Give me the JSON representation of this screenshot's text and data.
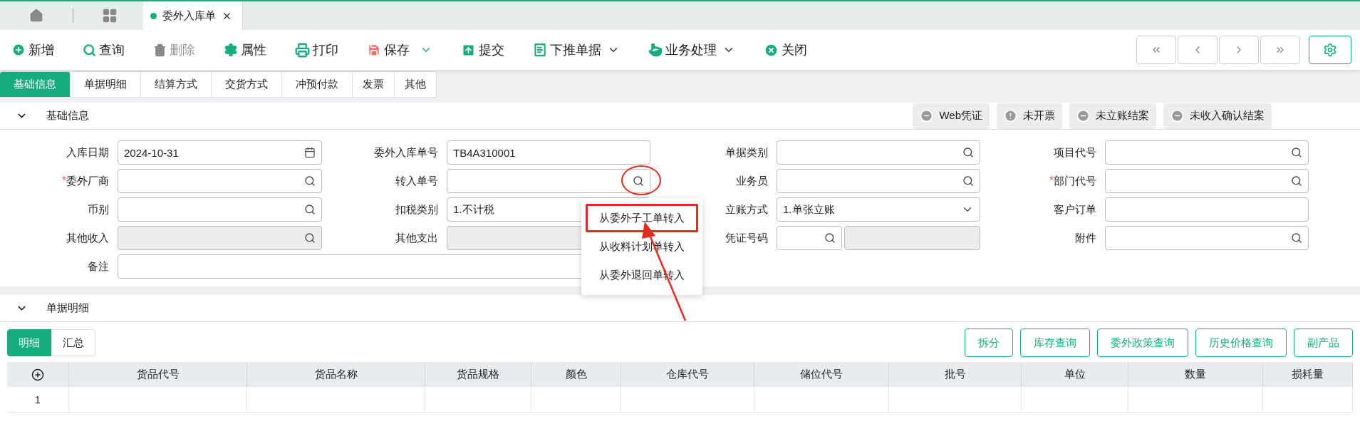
{
  "top_tabs": [
    {
      "label": "委外入库单",
      "selected": true
    }
  ],
  "toolbar": [
    {
      "label": "新增",
      "disabled": false,
      "dropdown": false
    },
    {
      "label": "查询",
      "disabled": false,
      "dropdown": false
    },
    {
      "label": "删除",
      "disabled": true,
      "dropdown": false
    },
    {
      "label": "属性",
      "disabled": false,
      "dropdown": false
    },
    {
      "label": "打印",
      "disabled": false,
      "dropdown": false
    },
    {
      "label": "保存",
      "disabled": false,
      "dropdown": true
    },
    {
      "label": "提交",
      "disabled": false,
      "dropdown": false
    },
    {
      "label": "下推单据",
      "disabled": false,
      "dropdown": true
    },
    {
      "label": "业务处理",
      "disabled": false,
      "dropdown": true
    },
    {
      "label": "关闭",
      "disabled": false,
      "dropdown": false
    }
  ],
  "tabs": [
    {
      "label": "基础信息",
      "selected": true
    },
    {
      "label": "单据明细",
      "selected": false
    },
    {
      "label": "结算方式",
      "selected": false
    },
    {
      "label": "交货方式",
      "selected": false
    },
    {
      "label": "冲预付款",
      "selected": false
    },
    {
      "label": "发票",
      "selected": false
    },
    {
      "label": "其他",
      "selected": false
    }
  ],
  "basic_section": {
    "title": "基础信息",
    "expanded": true,
    "status_buttons": [
      {
        "label": "Web凭证",
        "kind": "minus"
      },
      {
        "label": "未开票",
        "kind": "alert"
      },
      {
        "label": "未立账结案",
        "kind": "minus"
      },
      {
        "label": "未收入确认结案",
        "kind": "minus"
      }
    ],
    "rows": [
      [
        {
          "label": "入库日期",
          "kind": "date",
          "value": "2024-10-31",
          "disabled": false
        },
        {
          "label": "委外入库单号",
          "kind": "text",
          "value": "TB4A310001",
          "disabled": false
        },
        {
          "label": "单据类别",
          "kind": "lookup",
          "disabled": false
        },
        {
          "label": "项目代号",
          "kind": "lookup",
          "disabled": false
        }
      ],
      [
        {
          "label": "委外厂商",
          "kind": "lookup",
          "required_mark": "*",
          "disabled": false
        },
        {
          "label": "转入单号",
          "kind": "lookup",
          "disabled": false,
          "annotated": true
        },
        {
          "label": "业务员",
          "kind": "lookup",
          "disabled": false
        },
        {
          "label": "部门代号",
          "kind": "lookup",
          "required_mark": "*",
          "disabled": false
        }
      ],
      [
        {
          "label": "币别",
          "kind": "lookup",
          "disabled": false
        },
        {
          "label": "扣税类别",
          "kind": "select",
          "value": "1.不计税",
          "disabled": false
        },
        {
          "label": "立账方式",
          "kind": "select",
          "value": "1.单张立账",
          "disabled": false
        },
        {
          "label": "客户订单",
          "kind": "text",
          "disabled": false
        }
      ],
      [
        {
          "label": "其他收入",
          "kind": "lookup",
          "disabled": true
        },
        {
          "label": "其他支出",
          "kind": "lookup",
          "disabled": true
        },
        {
          "label": "凭证号码",
          "kind": "lookup_pair",
          "disabled": false
        },
        {
          "label": "附件",
          "kind": "lookup",
          "disabled": false
        }
      ],
      [
        {
          "label": "备注",
          "kind": "wide",
          "disabled": false
        }
      ]
    ]
  },
  "transfer_menu": {
    "items": [
      {
        "label": "从委外子工单转入",
        "highlighted": true
      },
      {
        "label": "从收料计划单转入",
        "highlighted": false
      },
      {
        "label": "从委外退回单转入",
        "highlighted": false
      }
    ]
  },
  "detail_section": {
    "title": "单据明细",
    "expanded": true,
    "view_tabs": [
      {
        "label": "明细",
        "selected": true
      },
      {
        "label": "汇总",
        "selected": false
      }
    ],
    "buttons": [
      "拆分",
      "库存查询",
      "委外政策查询",
      "历史价格查询",
      "副产品"
    ],
    "table": {
      "columns": [
        "货品代号",
        "货品名称",
        "货品规格",
        "颜色",
        "仓库代号",
        "储位代号",
        "批号",
        "单位",
        "数量",
        "损耗量"
      ],
      "rows": [
        {
          "number": "1"
        }
      ]
    }
  }
}
